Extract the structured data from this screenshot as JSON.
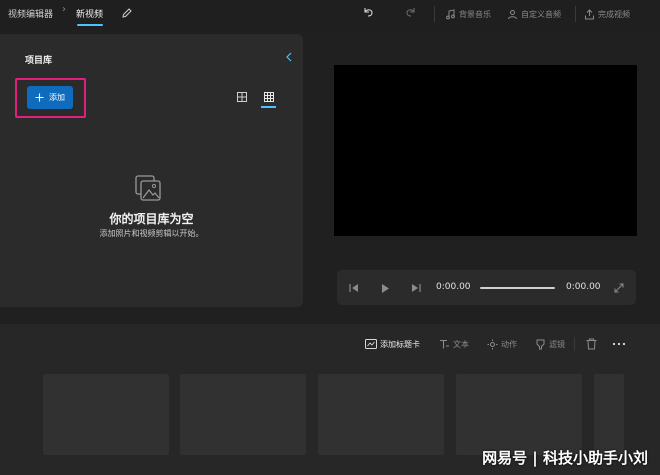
{
  "app": {
    "breadcrumb_parent": "视频编辑器",
    "breadcrumb_current": "新视频"
  },
  "toolbar": {
    "bg_music_label": "背景音乐",
    "custom_audio_label": "自定义音频",
    "finish_label": "完成视频"
  },
  "library": {
    "title": "项目库",
    "add_label": "添加",
    "empty_title": "你的项目库为空",
    "empty_subtitle": "添加照片和视频剪辑以开始。"
  },
  "playback": {
    "current_time": "0:00.00",
    "total_time": "0:00.00",
    "progress": 0
  },
  "storyboard": {
    "add_title_card_label": "添加标题卡",
    "text_label": "文本",
    "motion_label": "动作",
    "filter_label": "滤镜",
    "slot_count": 5
  },
  "watermark": "网易号 | 科技小助手小刘",
  "colors": {
    "accent": "#4cc2ff",
    "button_blue": "#0f6cbd",
    "highlight_border": "#e0207a",
    "background": "#202020",
    "panel": "#2b2b2b"
  },
  "icons": [
    "edit-icon",
    "undo-icon",
    "redo-icon",
    "music-icon",
    "custom-audio-icon",
    "export-icon",
    "collapse-chevron-icon",
    "plus-icon",
    "grid-large-icon",
    "grid-small-icon",
    "empty-media-icon",
    "skip-back-icon",
    "play-icon",
    "skip-forward-icon",
    "fullscreen-icon",
    "title-card-icon",
    "text-icon",
    "motion-icon",
    "filter-icon",
    "delete-icon",
    "more-icon"
  ]
}
